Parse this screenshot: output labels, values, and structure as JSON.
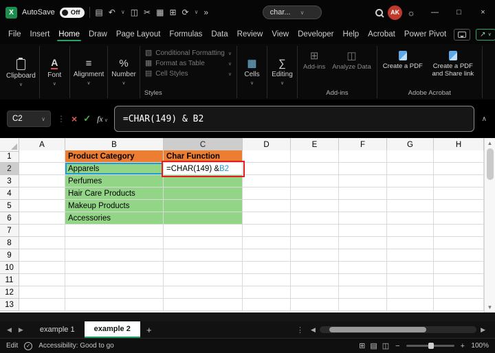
{
  "titlebar": {
    "autosave_label": "AutoSave",
    "autosave_state": "Off",
    "qat_icons": [
      "save-icon",
      "undo-icon",
      "caret-down",
      "copy-icon",
      "cut-icon",
      "paste-icon",
      "insert-cells-icon",
      "refresh-icon",
      "caret-down",
      "more-icon"
    ],
    "search_text": "char...",
    "avatar_initials": "AK"
  },
  "menubar": {
    "items": [
      "File",
      "Insert",
      "Home",
      "Draw",
      "Page Layout",
      "Formulas",
      "Data",
      "Review",
      "View",
      "Developer",
      "Help",
      "Acrobat",
      "Power Pivot"
    ],
    "active": "Home"
  },
  "ribbon": {
    "groups": [
      {
        "kind": "collapsed",
        "label": "Clipboard",
        "icon": "clipboard-css"
      },
      {
        "kind": "collapsed",
        "label": "Font",
        "icon": "font-icon"
      },
      {
        "kind": "collapsed",
        "label": "Alignment",
        "icon": "alignment-icon"
      },
      {
        "kind": "collapsed",
        "label": "Number",
        "icon": "number-icon"
      },
      {
        "kind": "stack",
        "label": "Styles",
        "disabled": true,
        "items": [
          {
            "label": "Conditional Formatting",
            "icon": "cond-format-icon"
          },
          {
            "label": "Format as Table",
            "icon": "format-table-icon"
          },
          {
            "label": "Cell Styles",
            "icon": "cell-styles-icon"
          }
        ]
      },
      {
        "kind": "collapsed",
        "label": "Cells",
        "icon": "cells-icon"
      },
      {
        "kind": "collapsed",
        "label": "Editing",
        "icon": "editing-icon"
      },
      {
        "kind": "buttons",
        "label": "Add-ins",
        "disabled": true,
        "items": [
          {
            "label": "Add-ins",
            "icon": "addins-icon"
          },
          {
            "label": "Analyze Data",
            "icon": "analyze-icon"
          }
        ]
      },
      {
        "kind": "buttons",
        "label": "Adobe Acrobat",
        "items": [
          {
            "label": "Create a PDF",
            "icon": "pdf-doc-css"
          },
          {
            "label": "Create a PDF and Share link",
            "icon": "pdf-doc-css"
          }
        ]
      }
    ]
  },
  "formula_bar": {
    "name_box": "C2",
    "fx_label": "fx",
    "formula": "=CHAR(149) & B2"
  },
  "grid": {
    "columns": [
      "A",
      "B",
      "C",
      "D",
      "E",
      "F",
      "G",
      "H"
    ],
    "row_count": 13,
    "selected_column": "C",
    "selected_row": 2,
    "cells": {
      "B1": {
        "text": "Product Category",
        "style": "orange-header"
      },
      "C1": {
        "text": "Char Function",
        "style": "orange-header"
      },
      "B2": {
        "text": "Apparels",
        "style": "ref-border"
      },
      "B3": {
        "text": "Perfumes",
        "style": "green"
      },
      "B4": {
        "text": "Hair Care Products",
        "style": "green"
      },
      "B5": {
        "text": "Makeup Products",
        "style": "green"
      },
      "B6": {
        "text": "Accessories",
        "style": "green"
      },
      "C2": {
        "style": "editing annotated",
        "parts": [
          {
            "text": "=CHAR(149) &",
            "color": "#000000"
          },
          {
            "text": " B2",
            "color": "#1D9BD8"
          }
        ]
      },
      "C3": {
        "style": "green"
      },
      "C4": {
        "style": "green"
      },
      "C5": {
        "style": "green"
      },
      "C6": {
        "style": "green"
      }
    }
  },
  "sheet_tabs": {
    "tabs": [
      {
        "label": "example 1",
        "active": false
      },
      {
        "label": "example 2",
        "active": true
      }
    ],
    "add_label": "+"
  },
  "status_bar": {
    "mode": "Edit",
    "accessibility": "Accessibility: Good to go",
    "accessibility_glyph": "✓",
    "view_icons": [
      "normal-view-icon",
      "page-layout-view-icon",
      "page-break-view-icon"
    ],
    "zoom": "100%"
  },
  "colors": {
    "accent_green": "#21A366",
    "orange_fill": "#ED7D31",
    "green_fill": "#92D587",
    "reference_blue": "#1D9BD8",
    "annotation_red": "#E31B1B",
    "avatar_red": "#C0392B"
  },
  "icons": {
    "save-icon": "▤",
    "undo-icon": "↶",
    "copy-icon": "◫",
    "cut-icon": "✂",
    "paste-icon": "▦",
    "insert-cells-icon": "⊞",
    "refresh-icon": "⟳",
    "more-icon": "»",
    "caret-down": "∨",
    "chevron-up-icon": "∧",
    "dots-icon": "⋮",
    "lightbulb-icon": "☼",
    "minimize-icon": "—",
    "maximize-icon": "□",
    "close-icon": "×",
    "cancel-icon": "×",
    "confirm-icon": "✓",
    "share-arrow-icon": "↗",
    "alignment-icon": "≡",
    "number-icon": "%",
    "font-icon": "A",
    "cells-icon": "▦",
    "editing-icon": "∑",
    "cond-format-icon": "▧",
    "format-table-icon": "▦",
    "cell-styles-icon": "▤",
    "addins-icon": "⊞",
    "analyze-icon": "◫",
    "tri-left": "◀",
    "tri-right": "▶",
    "tri-up": "▲",
    "tri-down": "▼",
    "normal-view-icon": "⊞",
    "page-layout-view-icon": "▤",
    "page-break-view-icon": "◫",
    "minus-icon": "−",
    "plus-icon": "+"
  }
}
